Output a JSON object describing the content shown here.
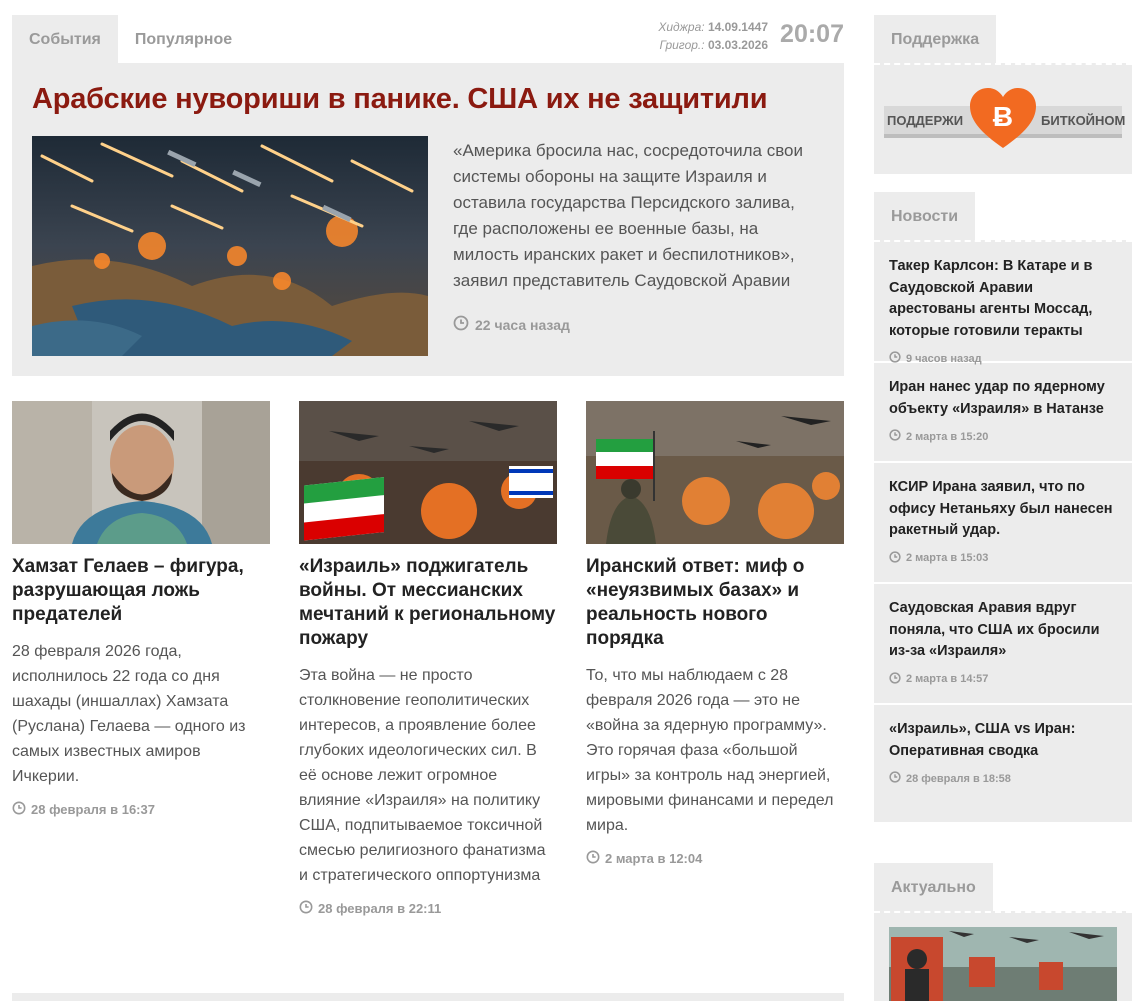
{
  "tabs": {
    "events": "События",
    "popular": "Популярное"
  },
  "dates": {
    "hijri_label": "Хиджра:",
    "hijri_value": "14.09.1447",
    "greg_label": "Григор.:",
    "greg_value": "03.03.2026",
    "time": "20:07"
  },
  "featured": {
    "title": "Арабские нувориши в панике. США их не защитили",
    "text": "«Америка бросила нас, сосредоточила свои системы обороны на защите Израиля и оставила государства Персидского залива, где расположены ее военные базы, на милость иранских ракет и беспилотников», заявил представитель Саудовской Аравии",
    "time": "22 часа назад"
  },
  "cards": [
    {
      "title": "Хамзат Гелаев – фигура, разрушающая ложь предателей",
      "text": "28 февраля 2026 года, исполнилось 22 года со дня шахады (иншаллах) Хамзата (Руслана) Гелаева — одного из самых известных амиров Ичкерии.",
      "time": "28 февраля в 16:37"
    },
    {
      "title": "«Израиль» поджигатель войны. От мессианских мечтаний к региональному пожару",
      "text": "Эта война — не просто столкновение геополитических интересов, а проявление более глубоких идеологических сил. В её основе лежит огромное влияние «Израиля» на политику США, подпитываемое токсичной смесью религиозного фанатизма и стратегического оппортунизма",
      "time": "28 февраля в 22:11"
    },
    {
      "title": "Иранский ответ: миф о «неуязвимых базах» и реальность нового порядка",
      "text": "То, что мы наблюдаем с 28 февраля 2026 года — это не «война за ядерную программу». Это горячая фаза «большой игры» за контроль над энергией, мировыми финансами и передел мира.",
      "time": "2 марта в 12:04"
    }
  ],
  "sidebar": {
    "support_tab": "Поддержка",
    "support_banner": {
      "left": "ПОДДЕРЖИ",
      "right": "БИТКОЙНОМ"
    },
    "news_tab": "Новости",
    "news": [
      {
        "title": "Такер Карлсон: В Катаре и в Саудовской Аравии арестованы агенты Моссад, которые готовили теракты",
        "time": "9 часов назад"
      },
      {
        "title": "Иран нанес удар по ядерному объекту «Израиля» в Натанзе",
        "time": "2 марта в 15:20"
      },
      {
        "title": "КСИР Ирана заявил, что по офису Нетаньяху был нанесен ракетный удар.",
        "time": "2 марта в 15:03"
      },
      {
        "title": "Саудовская Аравия вдруг поняла, что США их бросили из-за «Израиля»",
        "time": "2 марта в 14:57"
      },
      {
        "title": "«Израиль», США vs Иран: Оперативная сводка",
        "time": "28 февраля в 18:58"
      }
    ],
    "actual_tab": "Актуально"
  },
  "colors": {
    "title_red": "#8b1a10",
    "panel_gray": "#ececec",
    "muted": "#999999",
    "bitcoin_orange": "#f26a21"
  }
}
